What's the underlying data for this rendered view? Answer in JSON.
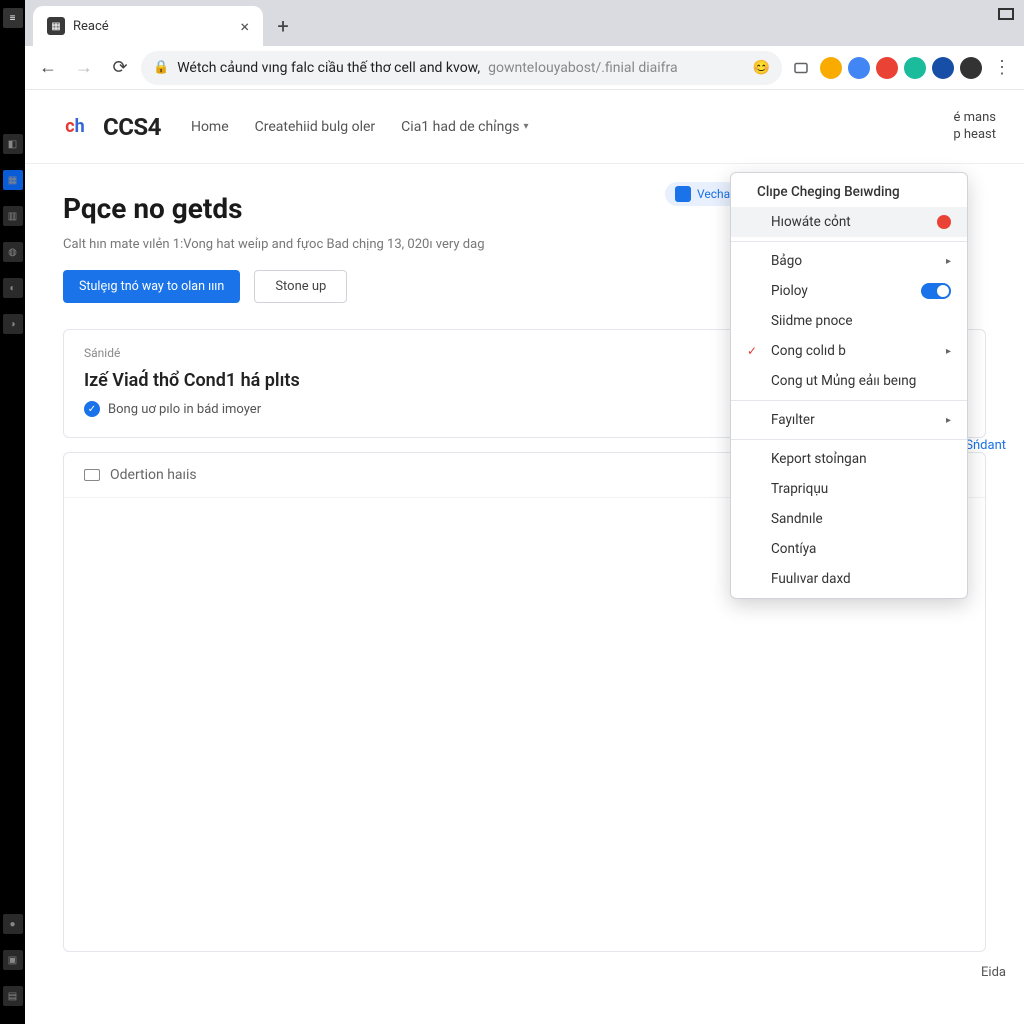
{
  "tab": {
    "title": "Reacé"
  },
  "addressbar": {
    "prefix": "Wétch cảund vıng falc ciầu thế thơ cell and kvow,",
    "suffix": "gownteIouyabost/.finial diaifra"
  },
  "site": {
    "logo_text": "CCS4",
    "logo_glyph_a": "c",
    "logo_glyph_b": "h",
    "nav": {
      "home": "Home",
      "create": "Createhiid bulg oler",
      "is": "Cia1 had de chỉngs"
    },
    "header_right_l1": "é mans",
    "header_right_l2": "p heast"
  },
  "pill": {
    "vechall": "Vechall"
  },
  "main": {
    "heading": "Pqce no getds",
    "subtitle": "Calt hın mate vılẻn 1:Vong hat weỉıp and fựoc Bad chịng 13, 020ı very dag",
    "btn_primary": "Stulȩıg tnó way to olan ııın",
    "btn_secondary": "Stone up"
  },
  "card1": {
    "tag": "Sánidé",
    "title": "Izế Viad́ thổ Cond1 há plıts",
    "row": "Bong uơ pılo in bád imoyer"
  },
  "card2": {
    "head": "Odertion haıis"
  },
  "side_word": "Sńdant",
  "footer_word": "Eida",
  "ctx": {
    "title": "Clıpe Cheging Beıwding",
    "items": [
      {
        "label": "Hıowáte cỏnt",
        "badge": "dot"
      },
      {
        "label": "Bảgo",
        "arrow": true
      },
      {
        "label": "Pioloy",
        "toggle": true
      },
      {
        "label": "Siidme pnoce"
      },
      {
        "label": "Cong colıd b",
        "arrow": true,
        "check": true
      },
      {
        "label": "Cong ut Mủng eảıı beıng"
      },
      {
        "label": "Fayılter",
        "arrow": true
      },
      {
        "label": "Keport stoỉngan"
      },
      {
        "label": "Trapriqụu"
      },
      {
        "label": "Sandnıle"
      },
      {
        "label": "Contíya"
      },
      {
        "label": "Fuulıvar daxd"
      }
    ]
  }
}
